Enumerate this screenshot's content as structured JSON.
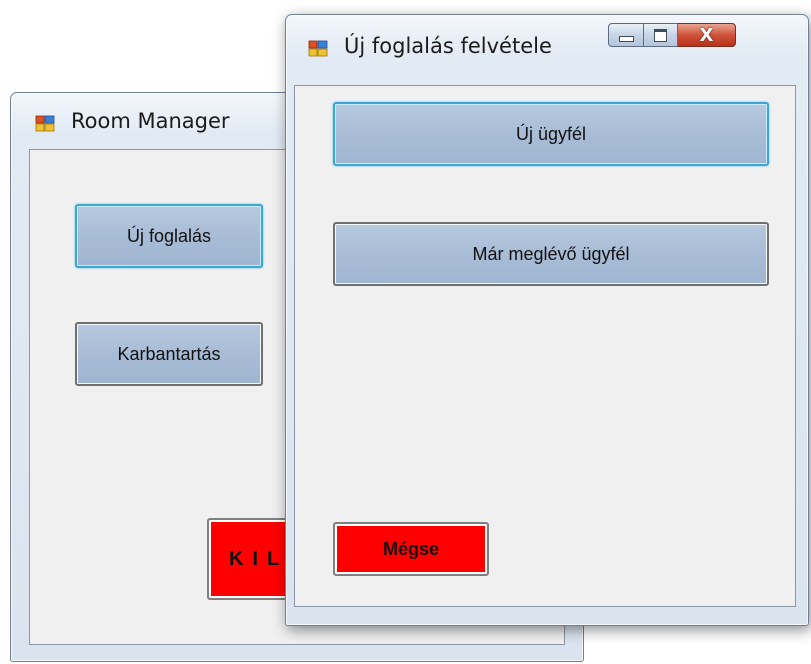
{
  "room_manager": {
    "title": "Room Manager",
    "buttons": {
      "new_booking": "Új foglalás",
      "maintenance": "Karbantartás",
      "exit": "KILÉPÉS"
    }
  },
  "new_booking_dialog": {
    "title": "Új foglalás felvétele",
    "buttons": {
      "new_customer": "Új ügyfél",
      "existing_customer": "Már meglévő ügyfél",
      "cancel": "Mégse"
    },
    "caption_buttons": {
      "close": "X"
    }
  },
  "colors": {
    "button_blue": "#a8bcd6",
    "focus_border": "#3da6d3",
    "danger_red": "#ff0000",
    "client_bg": "#f0f0f0"
  },
  "icons": [
    "app-window-icon",
    "minimize-icon",
    "maximize-icon",
    "close-icon"
  ]
}
